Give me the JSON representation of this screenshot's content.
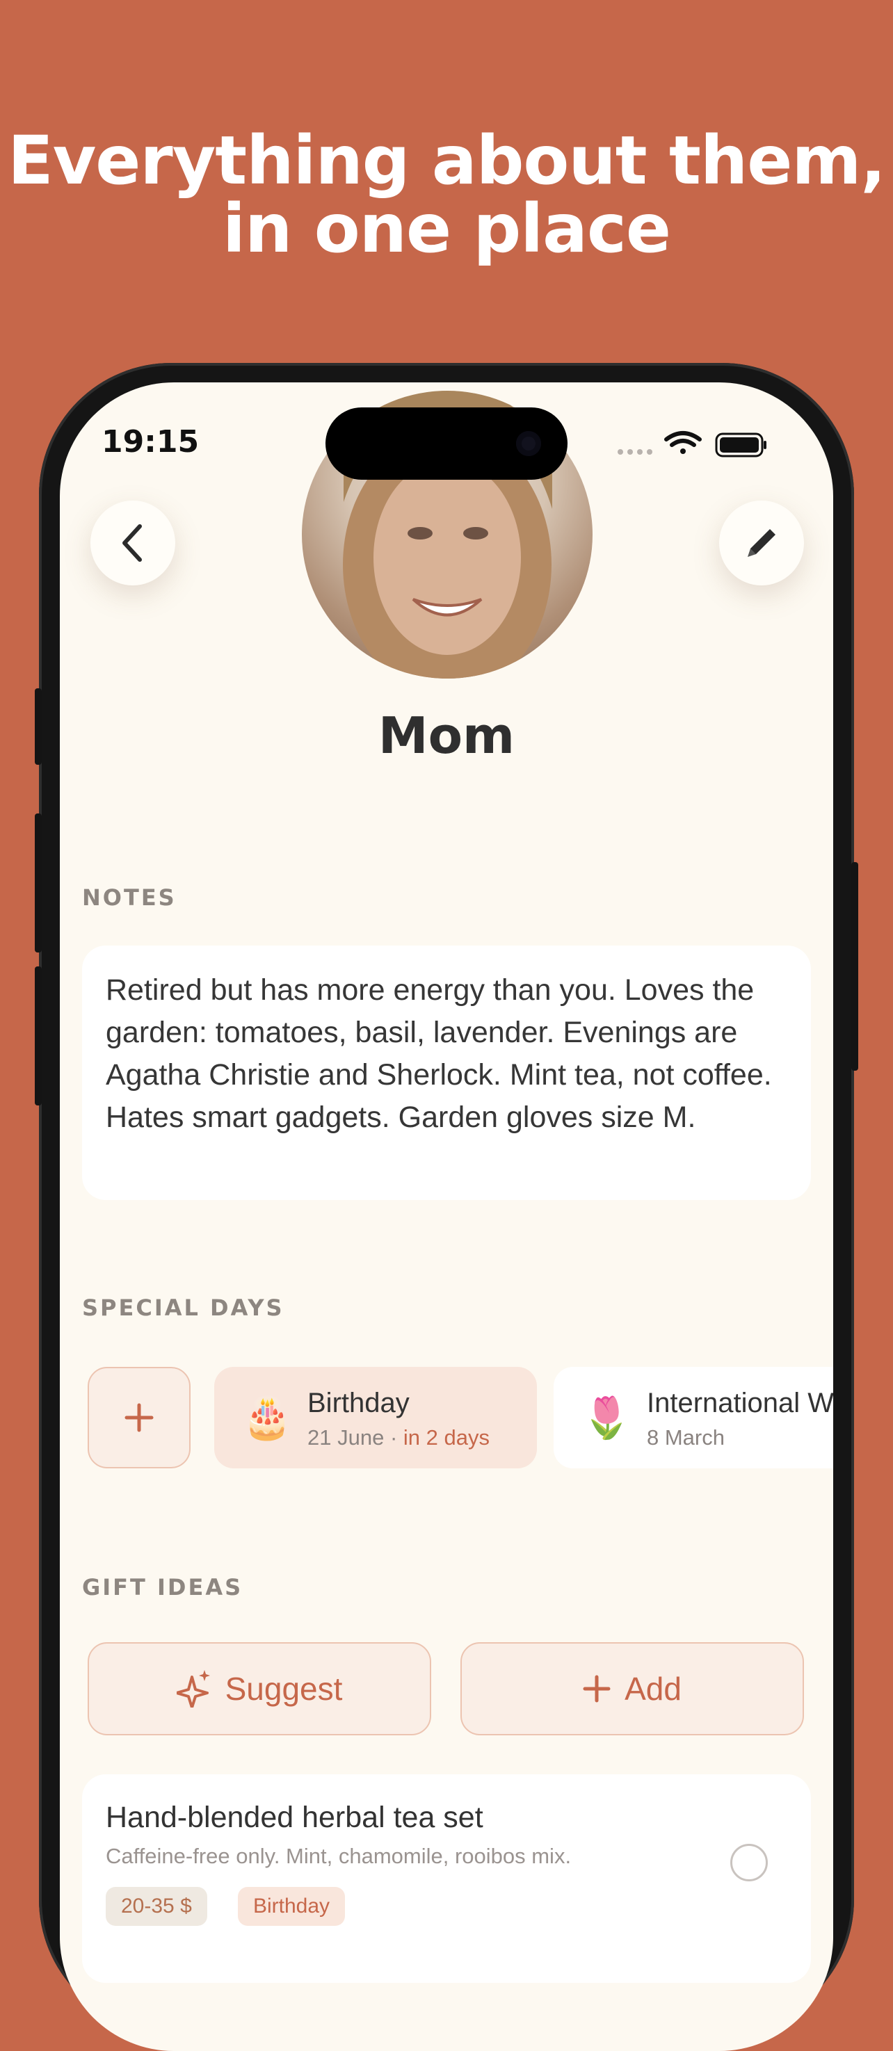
{
  "headline": {
    "line1": "Everything about them,",
    "line2": "in one place"
  },
  "status_bar": {
    "time": "19:15",
    "icons": [
      "signal-dots-icon",
      "wifi-icon",
      "battery-icon"
    ]
  },
  "header": {
    "back_icon": "chevron-left-icon",
    "edit_icon": "pencil-icon"
  },
  "profile": {
    "name": "Mom"
  },
  "notes": {
    "label": "NOTES",
    "text": "Retired but has more energy than you. Loves the garden: tomatoes, basil, lavender. Evenings are Agatha Christie and Sherlock. Mint tea, not coffee. Hates smart gadgets. Garden gloves size M."
  },
  "special_days": {
    "label": "SPECIAL DAYS",
    "add_icon": "plus-icon",
    "items": [
      {
        "emoji": "🎂",
        "title": "Birthday",
        "date": "21 June",
        "separator": "·",
        "countdown": "in 2 days"
      },
      {
        "emoji": "🌷",
        "title": "International W",
        "date": "8 March"
      }
    ]
  },
  "gift_ideas": {
    "label": "GIFT IDEAS",
    "suggest_label": "Suggest",
    "add_label": "Add",
    "items": [
      {
        "title": "Hand-blended herbal tea set",
        "description": "Caffeine-free only. Mint, chamomile, rooibos mix.",
        "tags": [
          "20-35 $",
          "Birthday"
        ]
      }
    ]
  },
  "colors": {
    "background": "#c6674a",
    "screen": "#fdf9f1",
    "accent": "#c6674a",
    "accent_soft": "#faeee6"
  }
}
